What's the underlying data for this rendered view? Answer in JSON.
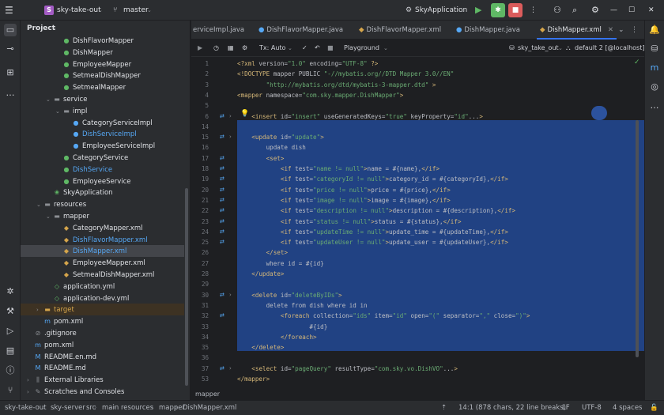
{
  "titlebar": {
    "project_badge": "S",
    "project_name": "sky-take-out",
    "branch": "master",
    "run_config": "SkyApplication"
  },
  "project_panel": {
    "title": "Project",
    "items": [
      {
        "label": "DishFlavorMapper",
        "icon": "interface-icon",
        "indent": 3,
        "kind": "class"
      },
      {
        "label": "DishMapper",
        "icon": "interface-icon",
        "indent": 3,
        "kind": "class"
      },
      {
        "label": "EmployeeMapper",
        "icon": "interface-icon",
        "indent": 3,
        "kind": "class"
      },
      {
        "label": "SetmealDishMapper",
        "icon": "interface-icon",
        "indent": 3,
        "kind": "class"
      },
      {
        "label": "SetmealMapper",
        "icon": "interface-icon",
        "indent": 3,
        "kind": "class"
      },
      {
        "label": "service",
        "icon": "folder-icon",
        "indent": 2,
        "kind": "folder"
      },
      {
        "label": "impl",
        "icon": "folder-icon",
        "indent": 3,
        "kind": "folder"
      },
      {
        "label": "CategoryServiceImpl",
        "icon": "class-icon",
        "indent": 4,
        "kind": "class"
      },
      {
        "label": "DishServiceImpl",
        "icon": "class-icon",
        "indent": 4,
        "kind": "class-blue"
      },
      {
        "label": "EmployeeServiceImpl",
        "icon": "class-icon",
        "indent": 4,
        "kind": "class"
      },
      {
        "label": "CategoryService",
        "icon": "interface-icon",
        "indent": 3,
        "kind": "class"
      },
      {
        "label": "DishService",
        "icon": "interface-icon",
        "indent": 3,
        "kind": "class-blue"
      },
      {
        "label": "EmployeeService",
        "icon": "interface-icon",
        "indent": 3,
        "kind": "class"
      },
      {
        "label": "SkyApplication",
        "icon": "spring-icon",
        "indent": 2,
        "kind": "class"
      },
      {
        "label": "resources",
        "icon": "folder-icon",
        "indent": 1,
        "kind": "folder"
      },
      {
        "label": "mapper",
        "icon": "folder-icon",
        "indent": 2,
        "kind": "folder"
      },
      {
        "label": "CategoryMapper.xml",
        "icon": "xml-icon",
        "indent": 3,
        "kind": "file"
      },
      {
        "label": "DishFlavorMapper.xml",
        "icon": "xml-icon",
        "indent": 3,
        "kind": "file-blue"
      },
      {
        "label": "DishMapper.xml",
        "icon": "xml-icon",
        "indent": 3,
        "kind": "file-blue-sel"
      },
      {
        "label": "EmployeeMapper.xml",
        "icon": "xml-icon",
        "indent": 3,
        "kind": "file"
      },
      {
        "label": "SetmealDishMapper.xml",
        "icon": "xml-icon",
        "indent": 3,
        "kind": "file"
      },
      {
        "label": "application.yml",
        "icon": "yml-icon",
        "indent": 2,
        "kind": "file"
      },
      {
        "label": "application-dev.yml",
        "icon": "yml-icon",
        "indent": 2,
        "kind": "file"
      },
      {
        "label": "target",
        "icon": "folder-icon",
        "indent": 1,
        "kind": "folder-orange"
      },
      {
        "label": "pom.xml",
        "icon": "maven-icon",
        "indent": 1,
        "kind": "file"
      },
      {
        "label": ".gitignore",
        "icon": "gitignore-icon",
        "indent": 0,
        "kind": "file"
      },
      {
        "label": "pom.xml",
        "icon": "maven-icon",
        "indent": 0,
        "kind": "file"
      },
      {
        "label": "README.en.md",
        "icon": "markdown-icon",
        "indent": 0,
        "kind": "file"
      },
      {
        "label": "README.md",
        "icon": "markdown-icon",
        "indent": 0,
        "kind": "file"
      },
      {
        "label": "External Libraries",
        "icon": "library-icon",
        "indent": 0,
        "kind": "folder"
      },
      {
        "label": "Scratches and Consoles",
        "icon": "scratch-icon",
        "indent": 0,
        "kind": "folder"
      }
    ]
  },
  "tabs": [
    {
      "label": "erviceImpl.java",
      "active": false
    },
    {
      "label": "DishFlavorMapper.java",
      "active": false
    },
    {
      "label": "DishFlavorMapper.xml",
      "active": false
    },
    {
      "label": "DishMapper.java",
      "active": false
    },
    {
      "label": "DishMapper.xml",
      "active": true
    }
  ],
  "editor_toolbar": {
    "tx": "Tx: Auto",
    "playground": "Playground",
    "datasource": "sky_take_out",
    "schema": "default 2 [@localhost]"
  },
  "code_lines": [
    {
      "n": "1",
      "text": "<?xml version=\"1.0\" encoding=\"UTF-8\" ?>"
    },
    {
      "n": "2",
      "text": "<!DOCTYPE mapper PUBLIC \"-//mybatis.org//DTD Mapper 3.0//EN\""
    },
    {
      "n": "3",
      "text": "        \"http://mybatis.org/dtd/mybatis-3-mapper.dtd\" >"
    },
    {
      "n": "4",
      "text": "<mapper namespace=\"com.sky.mapper.DishMapper\">"
    },
    {
      "n": "5",
      "text": ""
    },
    {
      "n": "6",
      "text": "    <insert id=\"insert\" useGeneratedKeys=\"true\" keyProperty=\"id\"...>"
    },
    {
      "n": "14",
      "text": ""
    },
    {
      "n": "15",
      "text": "    <update id=\"update\">"
    },
    {
      "n": "16",
      "text": "        update dish"
    },
    {
      "n": "17",
      "text": "        <set>"
    },
    {
      "n": "18",
      "text": "            <if test=\"name != null\">name = #{name},</if>"
    },
    {
      "n": "19",
      "text": "            <if test=\"categoryId != null\">category_id = #{categoryId},</if>"
    },
    {
      "n": "20",
      "text": "            <if test=\"price != null\">price = #{price},</if>"
    },
    {
      "n": "21",
      "text": "            <if test=\"image != null\">image = #{image},</if>"
    },
    {
      "n": "22",
      "text": "            <if test=\"description != null\">description = #{description},</if>"
    },
    {
      "n": "23",
      "text": "            <if test=\"status != null\">status = #{status},</if>"
    },
    {
      "n": "24",
      "text": "            <if test=\"updateTime != null\">update_time = #{updateTime},</if>"
    },
    {
      "n": "25",
      "text": "            <if test=\"updateUser != null\">update_user = #{updateUser},</if>"
    },
    {
      "n": "26",
      "text": "        </set>"
    },
    {
      "n": "27",
      "text": "        where id = #{id}"
    },
    {
      "n": "28",
      "text": "    </update>"
    },
    {
      "n": "29",
      "text": ""
    },
    {
      "n": "30",
      "text": "    <delete id=\"deleteByIDs\">"
    },
    {
      "n": "31",
      "text": "        delete from dish where id in"
    },
    {
      "n": "32",
      "text": "            <foreach collection=\"ids\" item=\"id\" open=\"(\" separator=\",\" close=\")\">"
    },
    {
      "n": "33",
      "text": "                    #{id}"
    },
    {
      "n": "34",
      "text": "            </foreach>"
    },
    {
      "n": "35",
      "text": "    </delete>"
    },
    {
      "n": "36",
      "text": ""
    },
    {
      "n": "37",
      "text": "    <select id=\"pageQuery\" resultType=\"com.sky.vo.DishVO\"...>"
    },
    {
      "n": "53",
      "text": "</mapper>"
    }
  ],
  "editor_breadcrumb": "mapper",
  "statusbar": {
    "path": [
      "sky-take-out",
      "sky-server",
      "src",
      "main",
      "resources",
      "mapper",
      "DishMapper.xml"
    ],
    "position": "14:1 (878 chars, 22 line breaks)",
    "line_sep": "LF",
    "encoding": "UTF-8",
    "indent": "4 spaces"
  }
}
